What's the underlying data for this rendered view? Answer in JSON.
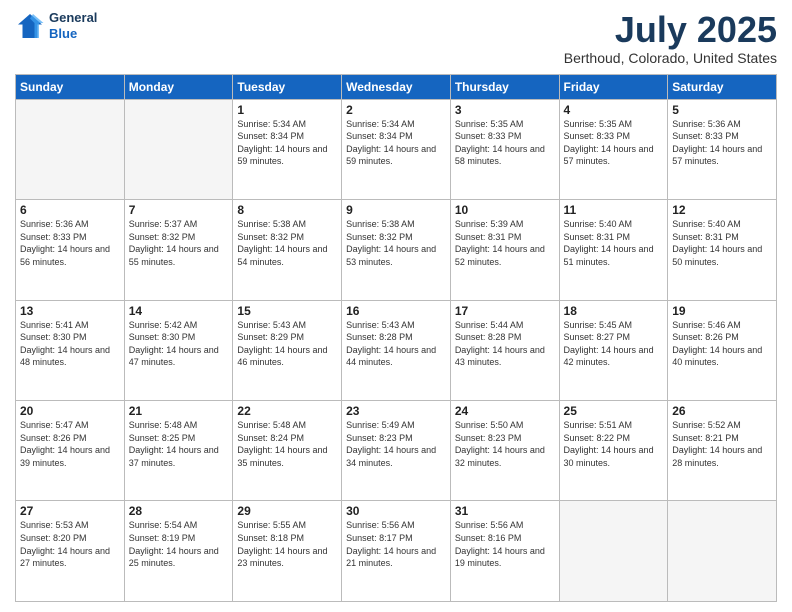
{
  "header": {
    "logo_line1": "General",
    "logo_line2": "Blue",
    "title": "July 2025",
    "subtitle": "Berthoud, Colorado, United States"
  },
  "days_of_week": [
    "Sunday",
    "Monday",
    "Tuesday",
    "Wednesday",
    "Thursday",
    "Friday",
    "Saturday"
  ],
  "weeks": [
    [
      {
        "day": "",
        "info": ""
      },
      {
        "day": "",
        "info": ""
      },
      {
        "day": "1",
        "info": "Sunrise: 5:34 AM\nSunset: 8:34 PM\nDaylight: 14 hours and 59 minutes."
      },
      {
        "day": "2",
        "info": "Sunrise: 5:34 AM\nSunset: 8:34 PM\nDaylight: 14 hours and 59 minutes."
      },
      {
        "day": "3",
        "info": "Sunrise: 5:35 AM\nSunset: 8:33 PM\nDaylight: 14 hours and 58 minutes."
      },
      {
        "day": "4",
        "info": "Sunrise: 5:35 AM\nSunset: 8:33 PM\nDaylight: 14 hours and 57 minutes."
      },
      {
        "day": "5",
        "info": "Sunrise: 5:36 AM\nSunset: 8:33 PM\nDaylight: 14 hours and 57 minutes."
      }
    ],
    [
      {
        "day": "6",
        "info": "Sunrise: 5:36 AM\nSunset: 8:33 PM\nDaylight: 14 hours and 56 minutes."
      },
      {
        "day": "7",
        "info": "Sunrise: 5:37 AM\nSunset: 8:32 PM\nDaylight: 14 hours and 55 minutes."
      },
      {
        "day": "8",
        "info": "Sunrise: 5:38 AM\nSunset: 8:32 PM\nDaylight: 14 hours and 54 minutes."
      },
      {
        "day": "9",
        "info": "Sunrise: 5:38 AM\nSunset: 8:32 PM\nDaylight: 14 hours and 53 minutes."
      },
      {
        "day": "10",
        "info": "Sunrise: 5:39 AM\nSunset: 8:31 PM\nDaylight: 14 hours and 52 minutes."
      },
      {
        "day": "11",
        "info": "Sunrise: 5:40 AM\nSunset: 8:31 PM\nDaylight: 14 hours and 51 minutes."
      },
      {
        "day": "12",
        "info": "Sunrise: 5:40 AM\nSunset: 8:31 PM\nDaylight: 14 hours and 50 minutes."
      }
    ],
    [
      {
        "day": "13",
        "info": "Sunrise: 5:41 AM\nSunset: 8:30 PM\nDaylight: 14 hours and 48 minutes."
      },
      {
        "day": "14",
        "info": "Sunrise: 5:42 AM\nSunset: 8:30 PM\nDaylight: 14 hours and 47 minutes."
      },
      {
        "day": "15",
        "info": "Sunrise: 5:43 AM\nSunset: 8:29 PM\nDaylight: 14 hours and 46 minutes."
      },
      {
        "day": "16",
        "info": "Sunrise: 5:43 AM\nSunset: 8:28 PM\nDaylight: 14 hours and 44 minutes."
      },
      {
        "day": "17",
        "info": "Sunrise: 5:44 AM\nSunset: 8:28 PM\nDaylight: 14 hours and 43 minutes."
      },
      {
        "day": "18",
        "info": "Sunrise: 5:45 AM\nSunset: 8:27 PM\nDaylight: 14 hours and 42 minutes."
      },
      {
        "day": "19",
        "info": "Sunrise: 5:46 AM\nSunset: 8:26 PM\nDaylight: 14 hours and 40 minutes."
      }
    ],
    [
      {
        "day": "20",
        "info": "Sunrise: 5:47 AM\nSunset: 8:26 PM\nDaylight: 14 hours and 39 minutes."
      },
      {
        "day": "21",
        "info": "Sunrise: 5:48 AM\nSunset: 8:25 PM\nDaylight: 14 hours and 37 minutes."
      },
      {
        "day": "22",
        "info": "Sunrise: 5:48 AM\nSunset: 8:24 PM\nDaylight: 14 hours and 35 minutes."
      },
      {
        "day": "23",
        "info": "Sunrise: 5:49 AM\nSunset: 8:23 PM\nDaylight: 14 hours and 34 minutes."
      },
      {
        "day": "24",
        "info": "Sunrise: 5:50 AM\nSunset: 8:23 PM\nDaylight: 14 hours and 32 minutes."
      },
      {
        "day": "25",
        "info": "Sunrise: 5:51 AM\nSunset: 8:22 PM\nDaylight: 14 hours and 30 minutes."
      },
      {
        "day": "26",
        "info": "Sunrise: 5:52 AM\nSunset: 8:21 PM\nDaylight: 14 hours and 28 minutes."
      }
    ],
    [
      {
        "day": "27",
        "info": "Sunrise: 5:53 AM\nSunset: 8:20 PM\nDaylight: 14 hours and 27 minutes."
      },
      {
        "day": "28",
        "info": "Sunrise: 5:54 AM\nSunset: 8:19 PM\nDaylight: 14 hours and 25 minutes."
      },
      {
        "day": "29",
        "info": "Sunrise: 5:55 AM\nSunset: 8:18 PM\nDaylight: 14 hours and 23 minutes."
      },
      {
        "day": "30",
        "info": "Sunrise: 5:56 AM\nSunset: 8:17 PM\nDaylight: 14 hours and 21 minutes."
      },
      {
        "day": "31",
        "info": "Sunrise: 5:56 AM\nSunset: 8:16 PM\nDaylight: 14 hours and 19 minutes."
      },
      {
        "day": "",
        "info": ""
      },
      {
        "day": "",
        "info": ""
      }
    ]
  ]
}
